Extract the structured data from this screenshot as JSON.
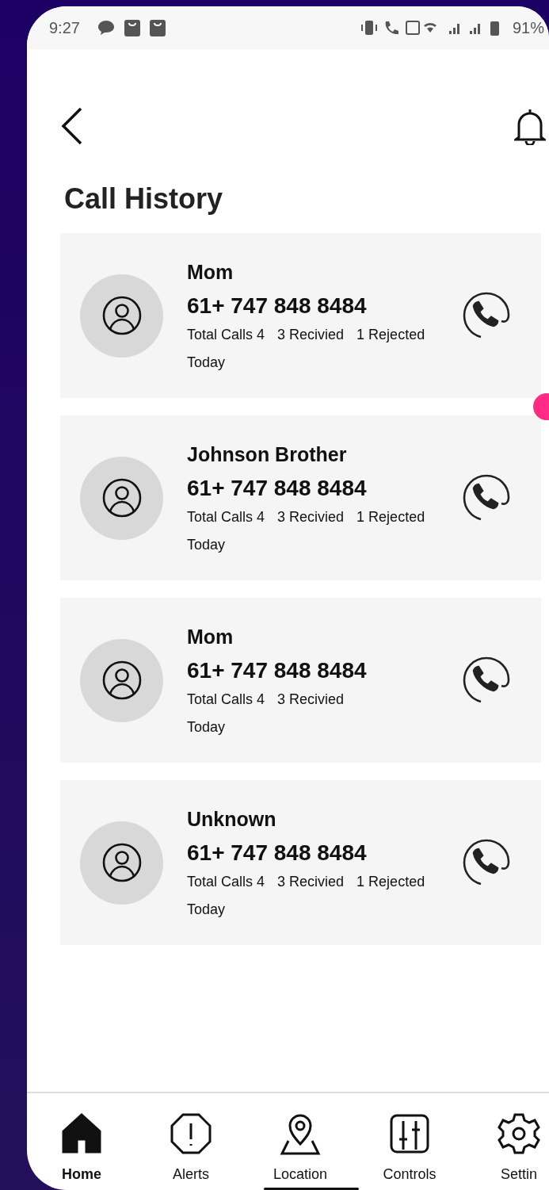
{
  "status_bar": {
    "time": "9:27",
    "battery": "91%"
  },
  "title": "Call History",
  "calls": [
    {
      "name": "Mom",
      "number": "61+ 747 848 8484",
      "stats": [
        "Total Calls 4",
        "3 Recivied",
        "1 Rejected"
      ],
      "when": "Today"
    },
    {
      "name": "Johnson Brother",
      "number": "61+ 747 848 8484",
      "stats": [
        "Total Calls 4",
        "3 Recivied",
        "1 Rejected"
      ],
      "when": "Today"
    },
    {
      "name": "Mom",
      "number": "61+ 747 848 8484",
      "stats": [
        "Total Calls 4",
        "3 Recivied"
      ],
      "when": "Today"
    },
    {
      "name": "Unknown",
      "number": "61+ 747 848 8484",
      "stats": [
        "Total Calls 4",
        "3 Recivied",
        "1 Rejected"
      ],
      "when": "Today"
    }
  ],
  "nav": [
    {
      "kind": "home",
      "label": "Home",
      "selected": true
    },
    {
      "kind": "alerts",
      "label": "Alerts",
      "selected": false
    },
    {
      "kind": "location",
      "label": "Location",
      "selected": false
    },
    {
      "kind": "controls",
      "label": "Controls",
      "selected": false
    },
    {
      "kind": "settings",
      "label": "Settin",
      "selected": false
    }
  ]
}
